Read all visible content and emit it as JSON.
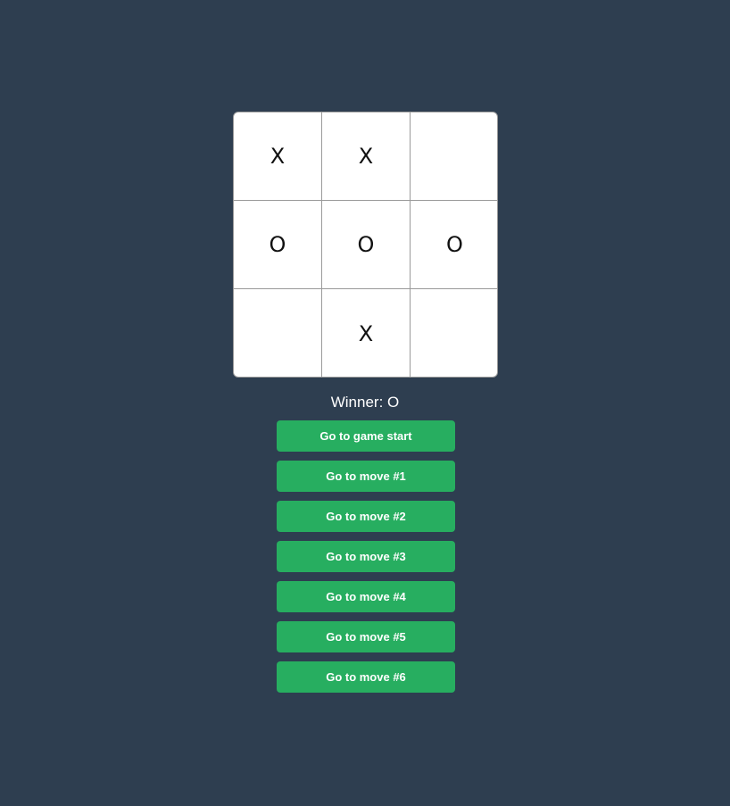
{
  "board": {
    "cells": [
      "X",
      "X",
      "",
      "O",
      "O",
      "O",
      "",
      "X",
      ""
    ]
  },
  "status": "Winner: O",
  "moves": [
    {
      "label": "Go to game start"
    },
    {
      "label": "Go to move #1"
    },
    {
      "label": "Go to move #2"
    },
    {
      "label": "Go to move #3"
    },
    {
      "label": "Go to move #4"
    },
    {
      "label": "Go to move #5"
    },
    {
      "label": "Go to move #6"
    }
  ],
  "colors": {
    "background": "#2e3e50",
    "button": "#27ae60",
    "board": "#ffffff"
  }
}
